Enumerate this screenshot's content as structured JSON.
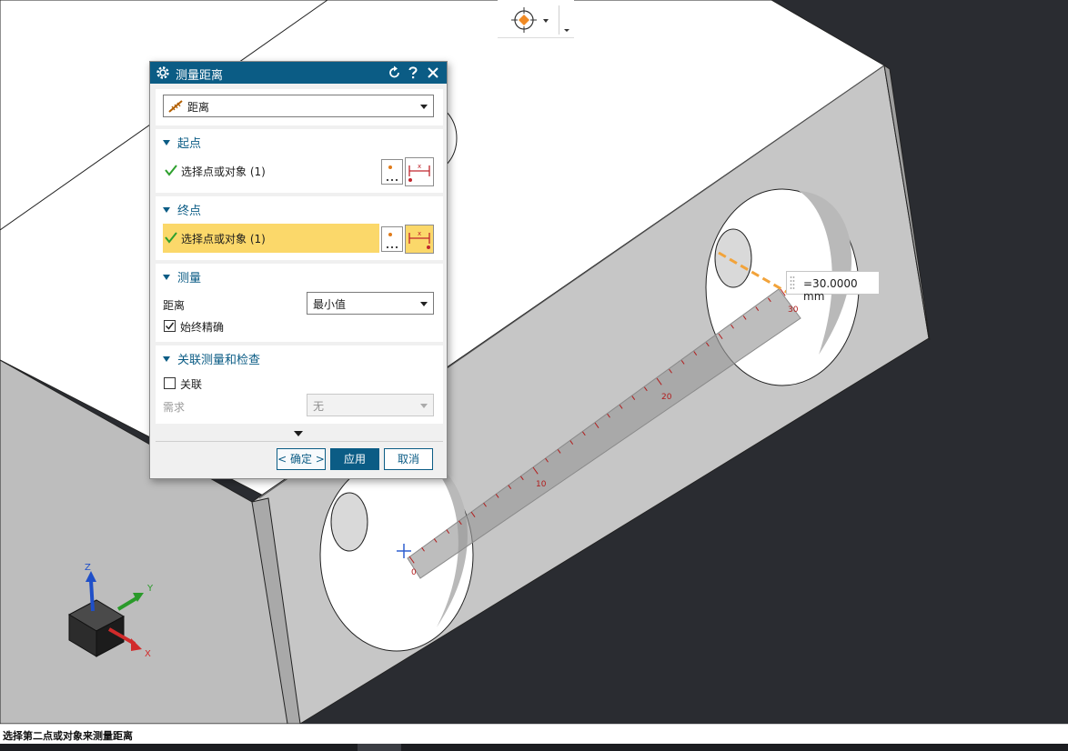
{
  "dialog": {
    "title": "测量距离",
    "type_value": "距离",
    "start_section": {
      "heading": "起点",
      "select_label": "选择点或对象 (1)"
    },
    "end_section": {
      "heading": "终点",
      "select_label": "选择点或对象 (1)"
    },
    "measure_section": {
      "heading": "测量",
      "distance_label": "距离",
      "distance_value": "最小值",
      "always_precise_label": "始终精确",
      "always_precise_checked": true
    },
    "associative_section": {
      "heading": "关联测量和检查",
      "associative_label": "关联",
      "associative_checked": false,
      "requirement_label": "需求",
      "requirement_value": "无"
    },
    "buttons": {
      "ok": "< 确定 >",
      "apply": "应用",
      "cancel": "取消"
    }
  },
  "measurement": {
    "value_text": "=30.0000 mm",
    "ruler_ticks": [
      "0",
      "10",
      "20",
      "30"
    ]
  },
  "triad": {
    "x": "X",
    "y": "Y",
    "z": "Z"
  },
  "status_bar": {
    "prompt": "选择第二点或对象来测量距离"
  },
  "colors": {
    "accent": "#0b5c85",
    "highlight": "#fbd86a",
    "background": "#2a2c31",
    "solid_face": "#c6c6c6",
    "solid_top": "#ffffff",
    "ruler_text": "#b21c1c",
    "dimension_line": "#f2a33a"
  }
}
